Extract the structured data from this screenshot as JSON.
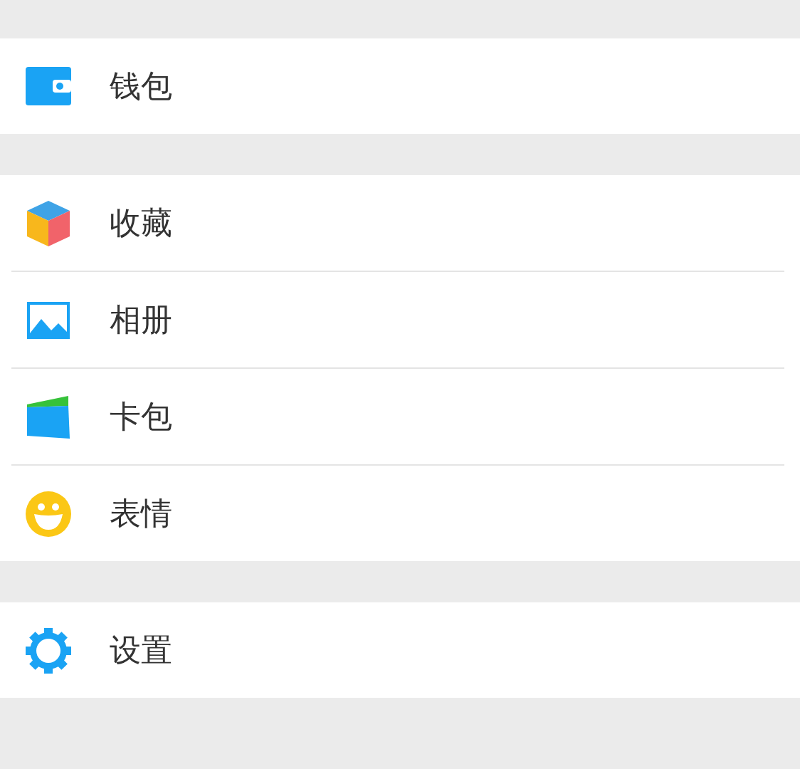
{
  "groups": [
    {
      "items": [
        {
          "kind": "wallet",
          "label": "钱包"
        }
      ]
    },
    {
      "items": [
        {
          "kind": "cube",
          "label": "收藏"
        },
        {
          "kind": "photo",
          "label": "相册"
        },
        {
          "kind": "card",
          "label": "卡包"
        },
        {
          "kind": "smiley",
          "label": "表情"
        }
      ]
    },
    {
      "items": [
        {
          "kind": "gear",
          "label": "设置"
        }
      ]
    }
  ]
}
